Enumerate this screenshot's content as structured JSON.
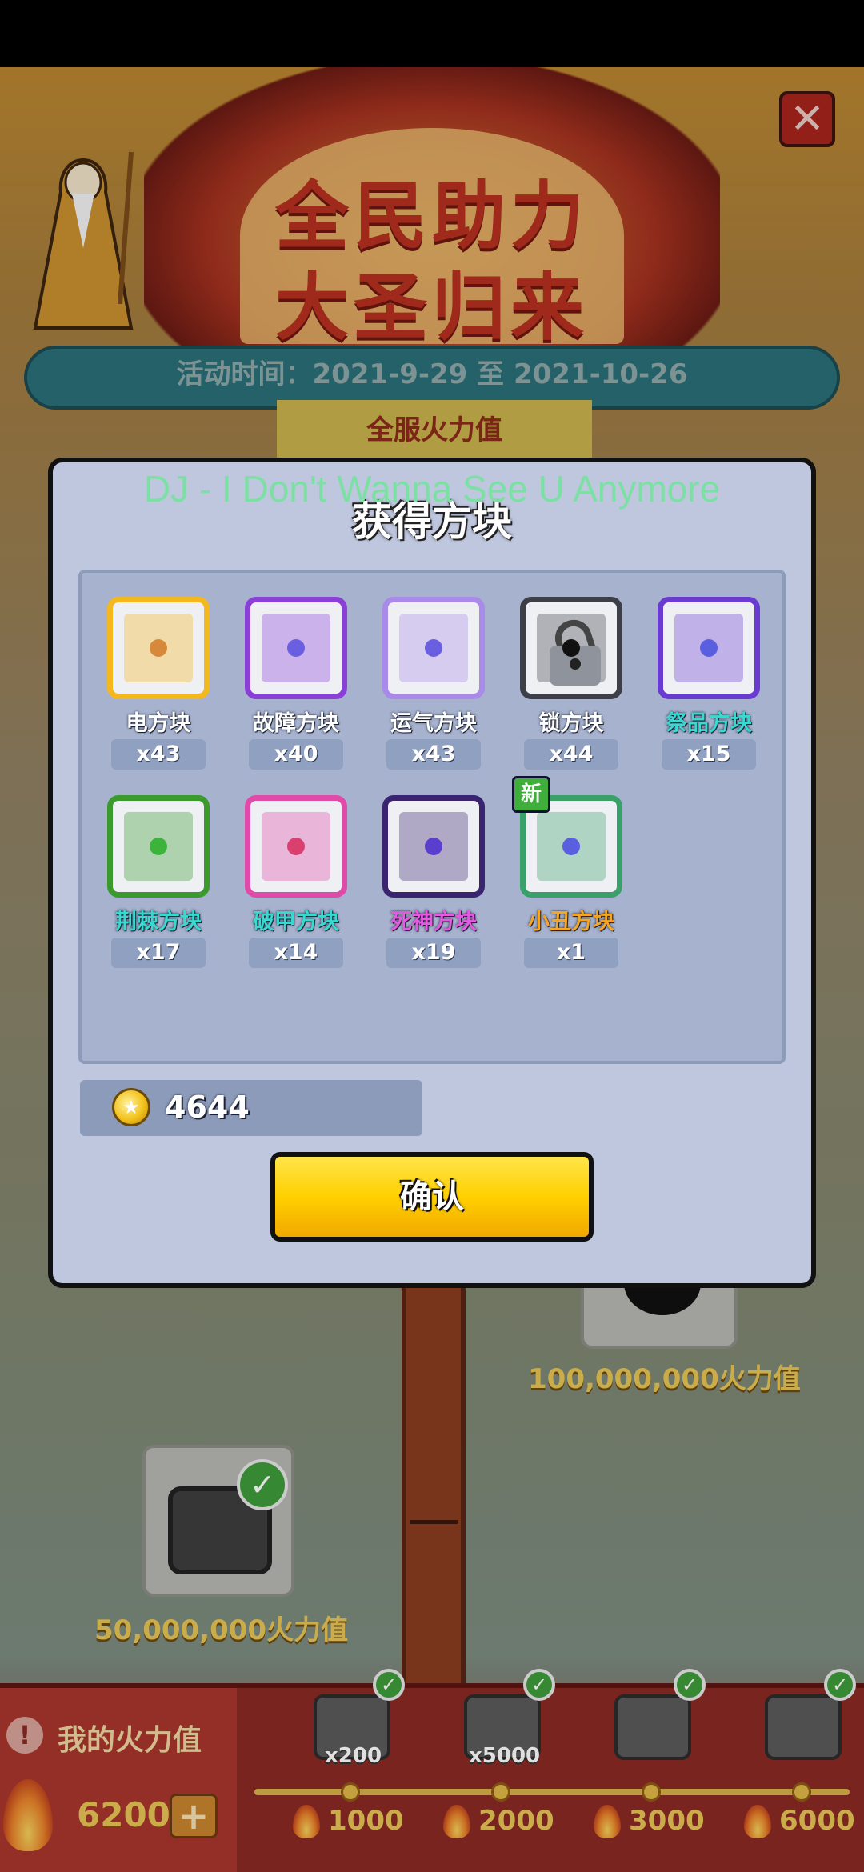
{
  "banner": {
    "title_line1": "全民助力",
    "title_line2": "大圣归来",
    "close_glyph": "✕"
  },
  "event": {
    "time_text": "活动时间：2021-9-29 至 2021-10-26",
    "fire_header": "全服火力值"
  },
  "rewards": {
    "tier2_label": "100,000,000火力值",
    "tier1_label": "50,000,000火力值",
    "check_glyph": "✓"
  },
  "bottom_bar": {
    "my_fire_label": "我的火力值",
    "warn_glyph": "!",
    "my_fire_value": "6200",
    "plus_glyph": "+",
    "milestones": [
      {
        "count": "x200",
        "value": "1000"
      },
      {
        "count": "x5000",
        "value": "2000"
      },
      {
        "count": "",
        "value": "3000"
      },
      {
        "count": "",
        "value": "6000"
      }
    ]
  },
  "song_overlay": "DJ - I Don't Wanna See U Anymore",
  "dialog": {
    "title": "获得方块",
    "new_badge": "新",
    "blocks": [
      {
        "name": "电方块",
        "count": "x43",
        "name_color": "#ffffff",
        "border": "#f5b81c",
        "dot": "#d6893a",
        "icon": "lightning-block-icon"
      },
      {
        "name": "故障方块",
        "count": "x40",
        "name_color": "#ffffff",
        "border": "#8a3fd6",
        "dot": "#6a5fe0",
        "icon": "glitch-block-icon"
      },
      {
        "name": "运气方块",
        "count": "x43",
        "name_color": "#ffffff",
        "border": "#a98ae8",
        "dot": "#6a5fe0",
        "icon": "luck-block-icon"
      },
      {
        "name": "锁方块",
        "count": "x44",
        "name_color": "#ffffff",
        "border": "#3c3f48",
        "dot": "#111111",
        "icon": "lock-block-icon"
      },
      {
        "name": "祭品方块",
        "count": "x15",
        "name_color": "#39d8d0",
        "border": "#6a3bd1",
        "dot": "#5a5fe0",
        "icon": "offering-block-icon"
      },
      {
        "name": "荆棘方块",
        "count": "x17",
        "name_color": "#39d8d0",
        "border": "#3a9a2c",
        "dot": "#3cb43c",
        "icon": "thorns-block-icon"
      },
      {
        "name": "破甲方块",
        "count": "x14",
        "name_color": "#39d8d0",
        "border": "#e04aa8",
        "dot": "#d94070",
        "icon": "armor-break-block-icon"
      },
      {
        "name": "死神方块",
        "count": "x19",
        "name_color": "#e45be0",
        "border": "#3a2470",
        "dot": "#5a3fcf",
        "icon": "reaper-block-icon"
      },
      {
        "name": "小丑方块",
        "count": "x1",
        "name_color": "#f5a623",
        "border": "#3aa06a",
        "dot": "#5a5fe0",
        "icon": "clown-block-icon"
      }
    ],
    "coins": "4644",
    "coin_glyph": "★",
    "confirm_label": "确认"
  }
}
